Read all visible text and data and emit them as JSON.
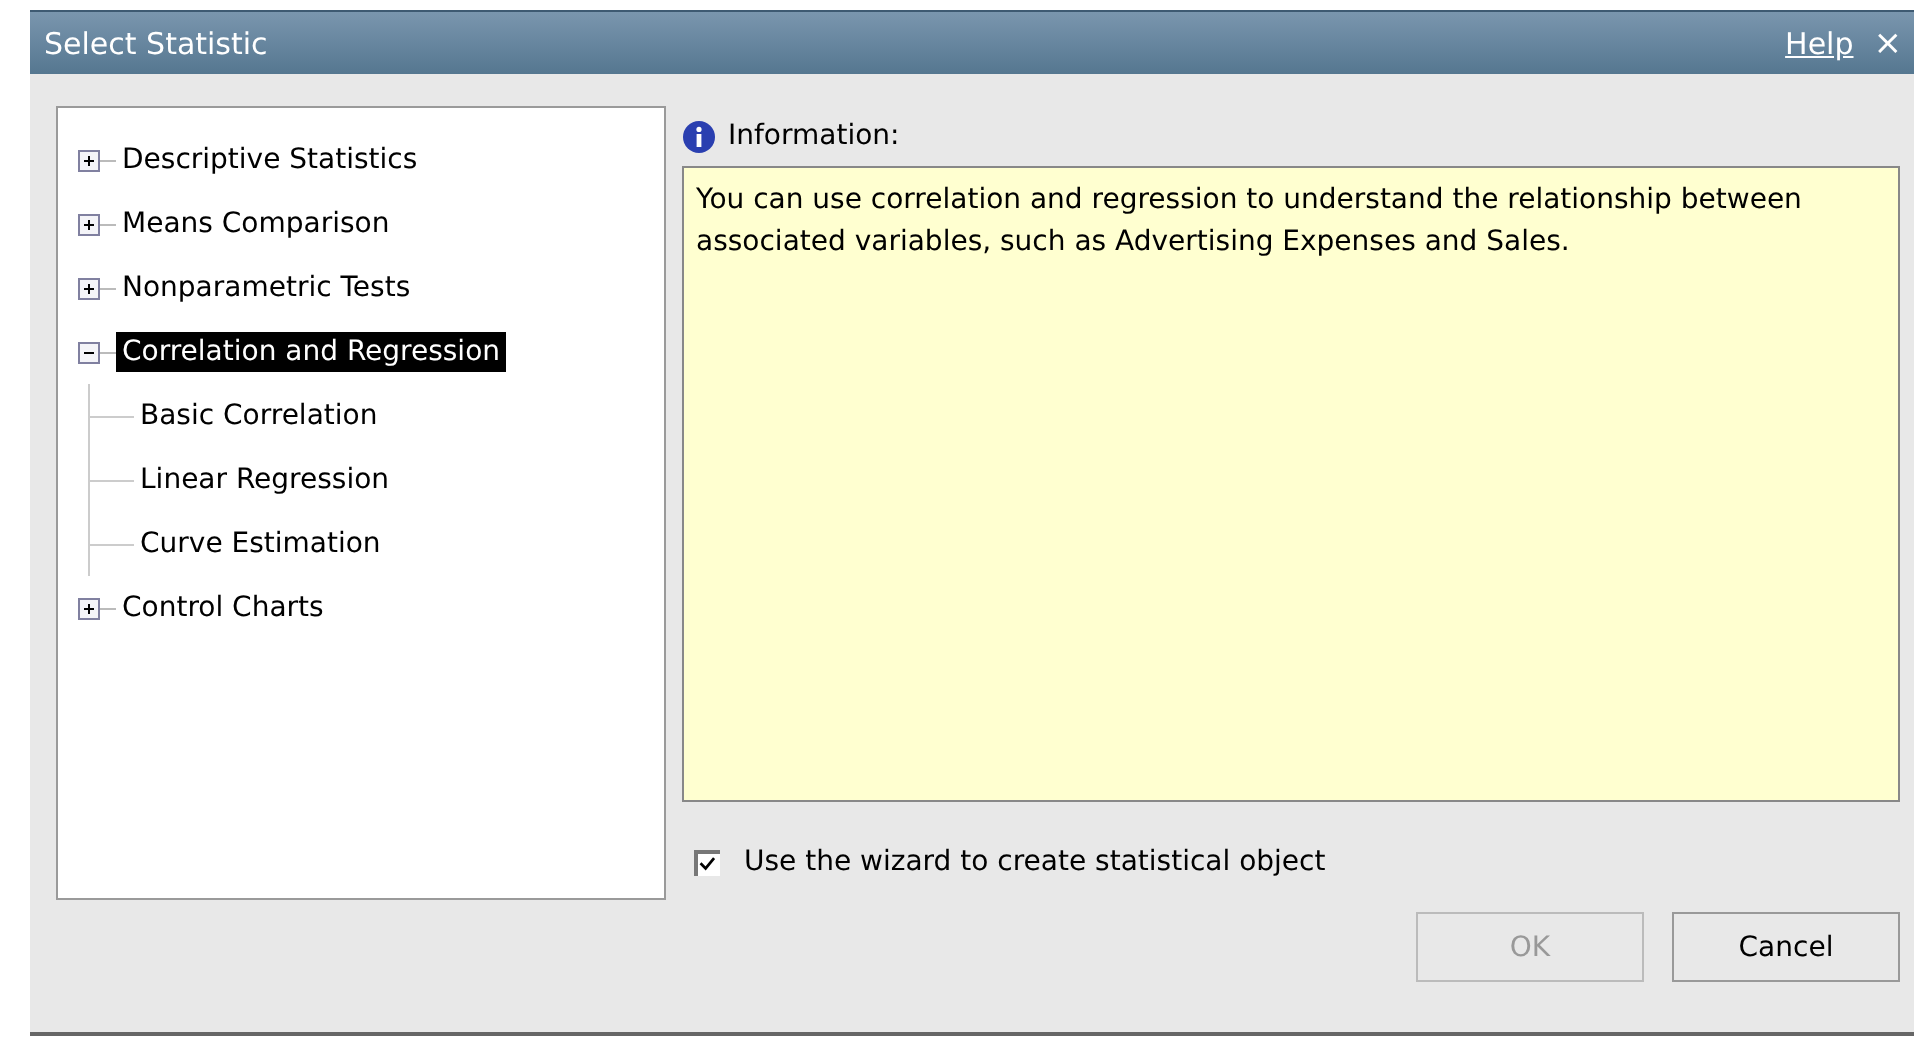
{
  "window": {
    "title": "Select Statistic",
    "help_link": "Help",
    "close": "×"
  },
  "tree": [
    {
      "label": "Descriptive Statistics",
      "expanded": false,
      "selected": false
    },
    {
      "label": "Means Comparison",
      "expanded": false,
      "selected": false
    },
    {
      "label": "Nonparametric Tests",
      "expanded": false,
      "selected": false
    },
    {
      "label": "Correlation and Regression",
      "expanded": true,
      "selected": true,
      "children": [
        {
          "label": "Basic Correlation",
          "selected": false
        },
        {
          "label": "Linear Regression",
          "selected": false
        },
        {
          "label": "Curve Estimation",
          "selected": false
        }
      ]
    },
    {
      "label": "Control Charts",
      "expanded": false,
      "selected": false
    }
  ],
  "information": {
    "label": "Information:",
    "text": "You can use correlation and regression to understand the relationship between associated variables, such as Advertising Expenses and Sales."
  },
  "wizard_option": {
    "label": "Use the wizard to create statistical object",
    "checked": true
  },
  "buttons": [
    {
      "label": "OK",
      "disabled": true
    },
    {
      "label": "Cancel",
      "disabled": false
    }
  ]
}
